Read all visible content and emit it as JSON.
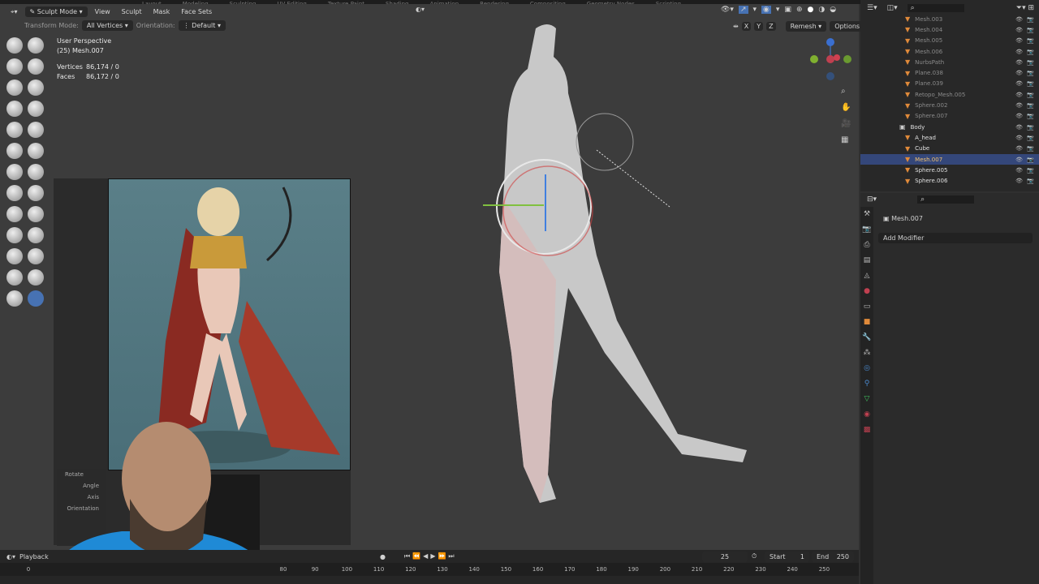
{
  "workspace_tabs": [
    "Layout",
    "Modeling",
    "Sculpting",
    "UV Editing",
    "Texture Paint",
    "Shading",
    "Animation",
    "Rendering",
    "Compositing",
    "Geometry Nodes",
    "Scripting"
  ],
  "header": {
    "mode": "Sculpt Mode",
    "menus": [
      "View",
      "Sculpt",
      "Mask",
      "Face Sets"
    ],
    "axes": [
      "X",
      "Y",
      "Z"
    ],
    "remesh": "Remesh",
    "options": "Options"
  },
  "toolsettings": {
    "transform_label": "Transform Mode:",
    "transform_value": "All Vertices",
    "orientation_label": "Orientation:",
    "orientation_value": "Default"
  },
  "overlay": {
    "view": "User Perspective",
    "object": "(25) Mesh.007",
    "vertices_label": "Vertices",
    "vertices": "86,174 / 0",
    "faces_label": "Faces",
    "faces": "86,172 / 0"
  },
  "last_op": {
    "title": "Rotate",
    "angle": "Angle",
    "axis": "Axis",
    "orientation": "Orientation"
  },
  "outliner": {
    "items": [
      {
        "name": "Mesh.003",
        "active": false
      },
      {
        "name": "Mesh.004",
        "active": false
      },
      {
        "name": "Mesh.005",
        "active": false
      },
      {
        "name": "Mesh.006",
        "active": false
      },
      {
        "name": "NurbsPath",
        "active": false
      },
      {
        "name": "Plane.038",
        "active": false
      },
      {
        "name": "Plane.039",
        "active": false
      },
      {
        "name": "Retopo_Mesh.005",
        "active": false
      },
      {
        "name": "Sphere.002",
        "active": false
      },
      {
        "name": "Sphere.007",
        "active": false
      }
    ],
    "collection": "Body",
    "body_items": [
      {
        "name": "A_head",
        "selected": false
      },
      {
        "name": "Cube",
        "selected": false
      },
      {
        "name": "Mesh.007",
        "selected": true
      },
      {
        "name": "Sphere.005",
        "selected": false
      },
      {
        "name": "Sphere.006",
        "selected": false
      }
    ]
  },
  "properties": {
    "object": "Mesh.007",
    "add_modifier": "Add Modifier"
  },
  "timeline": {
    "playback": "Playback",
    "current_frame": "25",
    "start_label": "Start",
    "start": "1",
    "end_label": "End",
    "end": "250",
    "ticks": [
      "0",
      "80",
      "90",
      "100",
      "110",
      "120",
      "130",
      "140",
      "150",
      "160",
      "170",
      "180",
      "190",
      "200",
      "210",
      "220",
      "230",
      "240",
      "250"
    ]
  },
  "colors": {
    "selection": "#34477a",
    "accent": "#4772b3",
    "viewport": "#3c3c3c"
  }
}
